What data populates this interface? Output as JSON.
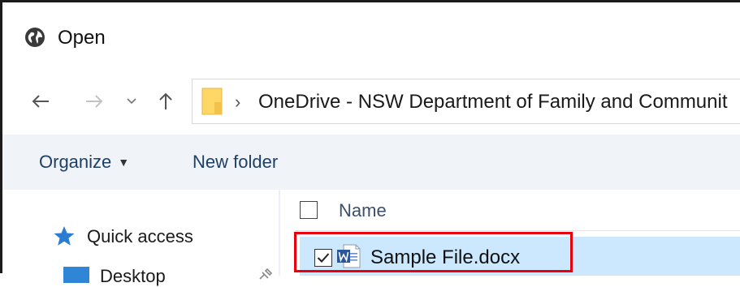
{
  "window": {
    "title": "Open",
    "title_icon": "globe-icon"
  },
  "navigation": {
    "back_icon": "arrow-left-icon",
    "forward_icon": "arrow-right-icon",
    "recent_icon": "chevron-down-icon",
    "up_icon": "arrow-up-icon",
    "address": {
      "folder_icon": "folder-icon",
      "separator": "›",
      "path": "OneDrive - NSW Department of Family and Communit"
    }
  },
  "toolbar": {
    "organize_label": "Organize",
    "organize_caret": "▼",
    "new_folder_label": "New folder"
  },
  "nav_pane": {
    "items": [
      {
        "label": "Quick access",
        "icon": "star-icon"
      },
      {
        "label": "Desktop",
        "icon": "desktop-icon",
        "pinned": true
      }
    ]
  },
  "file_list": {
    "columns": [
      {
        "label": "Name"
      }
    ],
    "rows": [
      {
        "name": "Sample File.docx",
        "icon": "word-document-icon",
        "checked": true,
        "selected": true
      }
    ]
  },
  "colors": {
    "toolbar_bg": "#f0f4f9",
    "selection_bg": "#cce8ff",
    "highlight_border": "#e8000b",
    "accent_text": "#1e3f66"
  }
}
